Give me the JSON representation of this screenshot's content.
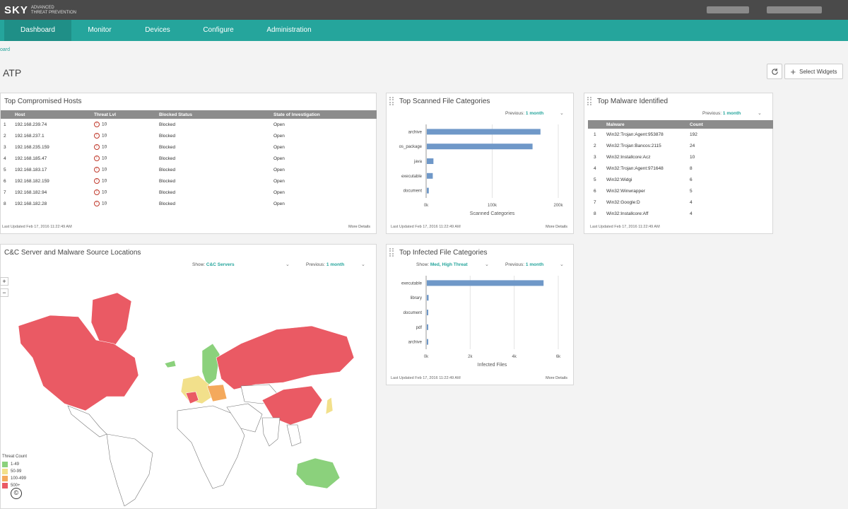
{
  "app": {
    "logo_big": "SKY",
    "logo_small_1": "ADVANCED",
    "logo_small_2": "THREAT PREVENTION"
  },
  "nav": {
    "items": [
      {
        "label": "Dashboard",
        "active": true
      },
      {
        "label": "Monitor",
        "active": false
      },
      {
        "label": "Devices",
        "active": false
      },
      {
        "label": "Configure",
        "active": false
      },
      {
        "label": "Administration",
        "active": false
      }
    ]
  },
  "breadcrumb": "oard",
  "page_title": "ATP",
  "toolbar": {
    "select_widgets_label": "Select Widgets"
  },
  "hosts_widget": {
    "title": "Top Compromised Hosts",
    "columns": [
      "Host",
      "Threat Lvl",
      "Blocked Status",
      "State of Investigation"
    ],
    "rows": [
      {
        "n": "1",
        "host": "192.168.239.74",
        "threat": "10",
        "status": "Blocked",
        "state": "Open"
      },
      {
        "n": "2",
        "host": "192.168.237.1",
        "threat": "10",
        "status": "Blocked",
        "state": "Open"
      },
      {
        "n": "3",
        "host": "192.168.235.159",
        "threat": "10",
        "status": "Blocked",
        "state": "Open"
      },
      {
        "n": "4",
        "host": "192.168.185.47",
        "threat": "10",
        "status": "Blocked",
        "state": "Open"
      },
      {
        "n": "5",
        "host": "192.168.183.17",
        "threat": "10",
        "status": "Blocked",
        "state": "Open"
      },
      {
        "n": "6",
        "host": "192.168.182.159",
        "threat": "10",
        "status": "Blocked",
        "state": "Open"
      },
      {
        "n": "7",
        "host": "192.168.182.94",
        "threat": "10",
        "status": "Blocked",
        "state": "Open"
      },
      {
        "n": "8",
        "host": "192.168.182.28",
        "threat": "10",
        "status": "Blocked",
        "state": "Open"
      }
    ],
    "footer": "Last Updated Feb 17, 2016 11:22:49 AM",
    "more": "More Details"
  },
  "scanned_widget": {
    "title": "Top Scanned File Categories",
    "prev_label": "Previous:",
    "prev_value": "1 month",
    "footer": "Last Updated Feb 17, 2016 11:22:49 AM",
    "more": "More Details"
  },
  "malware_widget": {
    "title": "Top Malware Identified",
    "prev_label": "Previous:",
    "prev_value": "1 month",
    "columns": [
      "Malware",
      "Count"
    ],
    "rows": [
      {
        "n": "1",
        "name": "Win32:Trojan:Agent:953878",
        "count": "192"
      },
      {
        "n": "2",
        "name": "Win32:Trojan:Bancos:2115",
        "count": "24"
      },
      {
        "n": "3",
        "name": "Win32:Installcore:Acz",
        "count": "10"
      },
      {
        "n": "4",
        "name": "Win32:Trojan:Agent:971648",
        "count": "8"
      },
      {
        "n": "5",
        "name": "Win32:Widgi",
        "count": "6"
      },
      {
        "n": "6",
        "name": "Win32:Winwrapper",
        "count": "5"
      },
      {
        "n": "7",
        "name": "Win32:Google:D",
        "count": "4"
      },
      {
        "n": "8",
        "name": "Win32:Installcore:Aff",
        "count": "4"
      }
    ],
    "footer": "Last Updated Feb 17, 2016 11:22:49 AM"
  },
  "map_widget": {
    "title": "C&C Server and Malware Source Locations",
    "show_label": "Show:",
    "show_value": "C&C Servers",
    "prev_label": "Previous:",
    "prev_value": "1 month",
    "zoom_in": "+",
    "zoom_out": "−",
    "legend_title": "Threat Count",
    "legend": [
      {
        "label": "1-49",
        "color": "#8bd17c"
      },
      {
        "label": "50-99",
        "color": "#f2e08b"
      },
      {
        "label": "100-499",
        "color": "#f4a95c"
      },
      {
        "label": "500+",
        "color": "#ea5a64"
      }
    ]
  },
  "infected_widget": {
    "title": "Top Infected File Categories",
    "show_label": "Show:",
    "show_value": "Med, High Threat",
    "prev_label": "Previous:",
    "prev_value": "1 month",
    "footer": "Last Updated Feb 17, 2016 11:22:49 AM",
    "more": "More Details"
  },
  "chart_data": [
    {
      "type": "bar",
      "orientation": "horizontal",
      "categories": [
        "archive",
        "os_package",
        "java",
        "executable",
        "document"
      ],
      "values": [
        172000,
        160000,
        10000,
        9000,
        3000
      ],
      "xlabel": "Scanned Categories",
      "xticks": [
        "0k",
        "100k",
        "200k"
      ],
      "xlim": [
        0,
        200000
      ],
      "color": "#6f98c8"
    },
    {
      "type": "bar",
      "orientation": "horizontal",
      "categories": [
        "executable",
        "library",
        "document",
        "pdf",
        "archive"
      ],
      "values": [
        5300,
        80,
        60,
        40,
        30
      ],
      "xlabel": "Infected Files",
      "xticks": [
        "0k",
        "2k",
        "4k",
        "6k"
      ],
      "xlim": [
        0,
        6000
      ],
      "color": "#6f98c8"
    }
  ]
}
